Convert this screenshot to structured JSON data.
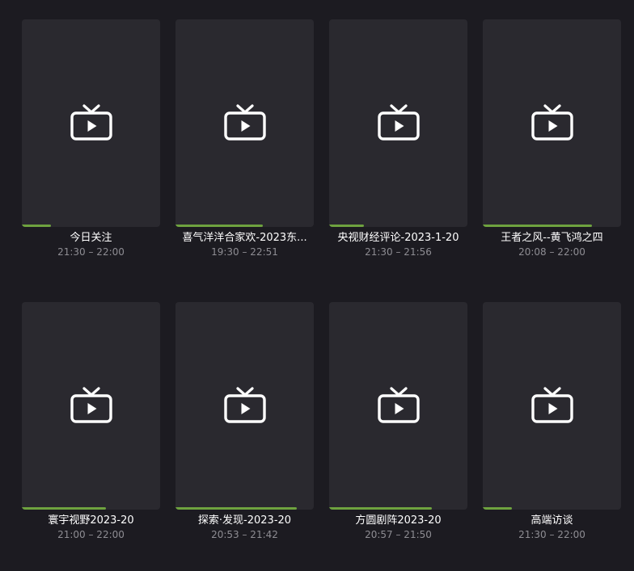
{
  "colors": {
    "background": "#1c1b21",
    "card": "#2a292f",
    "progress": "#6ea23f",
    "title": "#ffffff",
    "time": "#8e8d93"
  },
  "programs": [
    {
      "title": "今日关注",
      "time": "21:30 – 22:00",
      "progress": 0.21,
      "icon": "tv-play-icon"
    },
    {
      "title": "喜气洋洋合家欢-2023东...",
      "time": "19:30 – 22:51",
      "progress": 0.63,
      "icon": "tv-play-icon"
    },
    {
      "title": "央视财经评论-2023-1-20",
      "time": "21:30 – 21:56",
      "progress": 0.25,
      "icon": "tv-play-icon"
    },
    {
      "title": "王者之风--黄飞鸿之四",
      "time": "20:08 – 22:00",
      "progress": 0.79,
      "icon": "tv-play-icon"
    },
    {
      "title": "寰宇视野2023-20",
      "time": "21:00 – 22:00",
      "progress": 0.61,
      "icon": "tv-play-icon"
    },
    {
      "title": "探索·发现-2023-20",
      "time": "20:53 – 21:42",
      "progress": 0.88,
      "icon": "tv-play-icon"
    },
    {
      "title": "方圆剧阵2023-20",
      "time": "20:57 – 21:50",
      "progress": 0.74,
      "icon": "tv-play-icon"
    },
    {
      "title": "高端访谈",
      "time": "21:30 – 22:00",
      "progress": 0.21,
      "icon": "tv-play-icon"
    }
  ]
}
